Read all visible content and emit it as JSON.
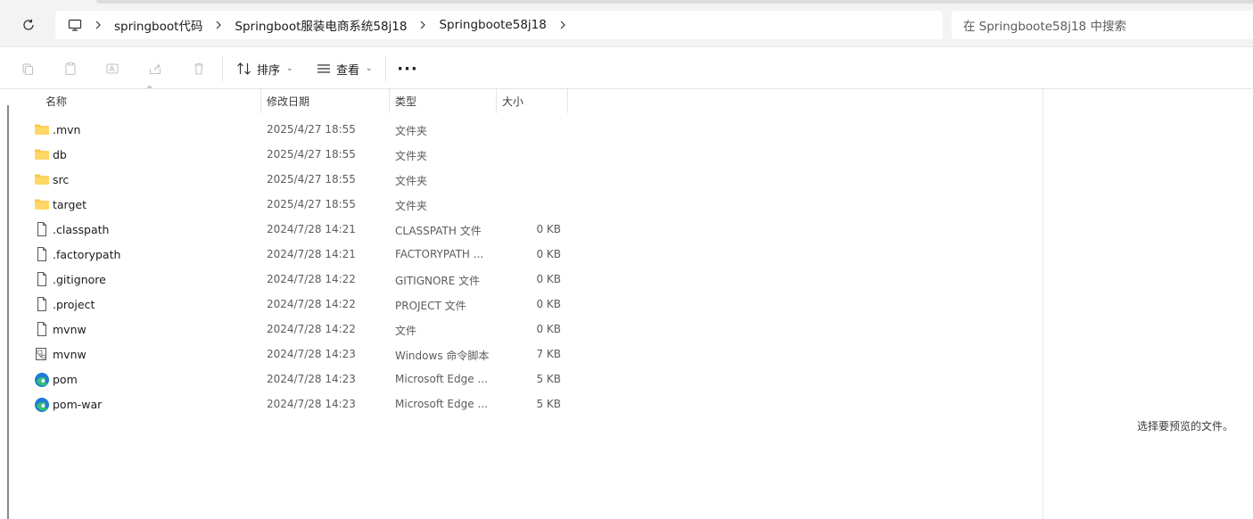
{
  "address_bar": {
    "breadcrumbs": [
      "springboot代码",
      "Springboot服装电商系统58j18",
      "Springboote58j18"
    ],
    "search_placeholder": "在 Springboote58j18 中搜索"
  },
  "toolbar": {
    "sort_label": "排序",
    "view_label": "查看",
    "more_label": "···"
  },
  "columns": {
    "name": "名称",
    "date": "修改日期",
    "type": "类型",
    "size": "大小"
  },
  "files": [
    {
      "name": ".mvn",
      "date": "2025/4/27 18:55",
      "type": "文件夹",
      "size": "",
      "icon": "folder-icon"
    },
    {
      "name": "db",
      "date": "2025/4/27 18:55",
      "type": "文件夹",
      "size": "",
      "icon": "folder-icon"
    },
    {
      "name": "src",
      "date": "2025/4/27 18:55",
      "type": "文件夹",
      "size": "",
      "icon": "folder-icon"
    },
    {
      "name": "target",
      "date": "2025/4/27 18:55",
      "type": "文件夹",
      "size": "",
      "icon": "folder-icon"
    },
    {
      "name": ".classpath",
      "date": "2024/7/28 14:21",
      "type": "CLASSPATH 文件",
      "size": "0 KB",
      "icon": "file-icon"
    },
    {
      "name": ".factorypath",
      "date": "2024/7/28 14:21",
      "type": "FACTORYPATH ...",
      "size": "0 KB",
      "icon": "file-icon"
    },
    {
      "name": ".gitignore",
      "date": "2024/7/28 14:22",
      "type": "GITIGNORE 文件",
      "size": "0 KB",
      "icon": "file-icon"
    },
    {
      "name": ".project",
      "date": "2024/7/28 14:22",
      "type": "PROJECT 文件",
      "size": "0 KB",
      "icon": "file-icon"
    },
    {
      "name": "mvnw",
      "date": "2024/7/28 14:22",
      "type": "文件",
      "size": "0 KB",
      "icon": "file-icon"
    },
    {
      "name": "mvnw",
      "date": "2024/7/28 14:23",
      "type": "Windows 命令脚本",
      "size": "7 KB",
      "icon": "script-icon"
    },
    {
      "name": "pom",
      "date": "2024/7/28 14:23",
      "type": "Microsoft Edge ...",
      "size": "5 KB",
      "icon": "edge-icon"
    },
    {
      "name": "pom-war",
      "date": "2024/7/28 14:23",
      "type": "Microsoft Edge ...",
      "size": "5 KB",
      "icon": "edge-icon"
    }
  ],
  "preview": {
    "message": "选择要预览的文件。"
  },
  "colors": {
    "folder": "#f8c846",
    "edge_blue": "#1f7ad8",
    "edge_green": "#35c16f"
  }
}
